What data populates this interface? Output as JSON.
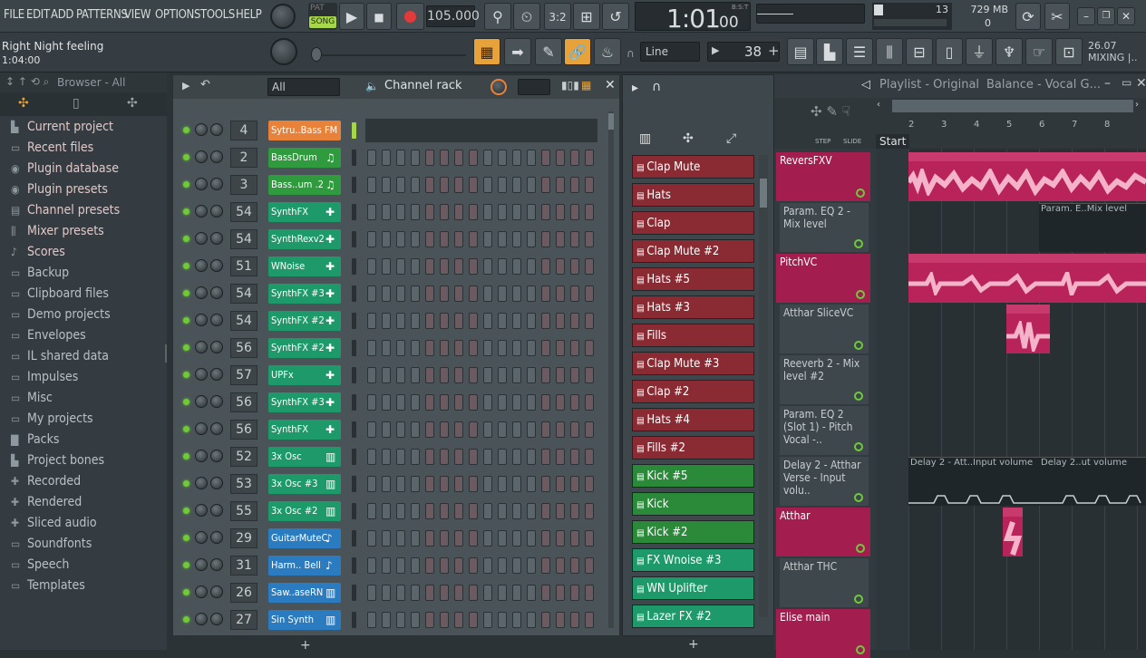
{
  "menu": [
    "FILE",
    "EDIT",
    "ADD",
    "PATTERNS",
    "VIEW",
    "OPTIONS",
    "TOOLS",
    "HELP"
  ],
  "transport": {
    "pat_label": "PAT",
    "song_label": "SONG",
    "tempo": "105.000",
    "time": "1:01",
    "time_sub": "00",
    "bst": "B:S:T"
  },
  "meters": {
    "cpu": "13",
    "mem": "729 MB",
    "poly": "0"
  },
  "hint": {
    "title": "Right Night feeling",
    "time": "1:04:00"
  },
  "toolbar2": {
    "snap": "Line",
    "step_value": "38",
    "news_date": "26.07",
    "news_text": "MIXING |.."
  },
  "browser": {
    "title": "Browser - All",
    "items": [
      {
        "label": "Current project",
        "icon": "project-icon"
      },
      {
        "label": "Recent files",
        "icon": "folder-recent-icon"
      },
      {
        "label": "Plugin database",
        "icon": "plugin-icon"
      },
      {
        "label": "Plugin presets",
        "icon": "plugin-icon"
      },
      {
        "label": "Channel presets",
        "icon": "channel-icon"
      },
      {
        "label": "Mixer presets",
        "icon": "mixer-icon"
      },
      {
        "label": "Scores",
        "icon": "note-icon"
      },
      {
        "label": "Backup",
        "icon": "folder-backup-icon"
      },
      {
        "label": "Clipboard files",
        "icon": "folder-icon"
      },
      {
        "label": "Demo projects",
        "icon": "folder-icon"
      },
      {
        "label": "Envelopes",
        "icon": "folder-icon"
      },
      {
        "label": "IL shared data",
        "icon": "folder-icon"
      },
      {
        "label": "Impulses",
        "icon": "folder-icon"
      },
      {
        "label": "Misc",
        "icon": "folder-icon"
      },
      {
        "label": "My projects",
        "icon": "folder-icon"
      },
      {
        "label": "Packs",
        "icon": "packs-icon"
      },
      {
        "label": "Project bones",
        "icon": "bones-icon"
      },
      {
        "label": "Recorded",
        "icon": "recorded-icon"
      },
      {
        "label": "Rendered",
        "icon": "rendered-icon"
      },
      {
        "label": "Sliced audio",
        "icon": "sliced-icon"
      },
      {
        "label": "Soundfonts",
        "icon": "folder-icon"
      },
      {
        "label": "Speech",
        "icon": "folder-icon"
      },
      {
        "label": "Templates",
        "icon": "folder-icon"
      }
    ]
  },
  "rack": {
    "filter": "All",
    "title": "Channel rack",
    "channels": [
      {
        "num": "4",
        "name": "Sytru..Bass FM",
        "color": "#e8823a",
        "icon": ""
      },
      {
        "num": "2",
        "name": "BassDrum",
        "color": "#2f9a3e",
        "icon": "♫"
      },
      {
        "num": "3",
        "name": "Bass..um .2",
        "color": "#2f9a3e",
        "icon": "♫"
      },
      {
        "num": "54",
        "name": "SynthFX",
        "color": "#1e9a6a",
        "icon": "✚"
      },
      {
        "num": "54",
        "name": "SynthRexv2",
        "color": "#1e9a6a",
        "icon": "✚"
      },
      {
        "num": "51",
        "name": "WNoise",
        "color": "#1e9a6a",
        "icon": "✚"
      },
      {
        "num": "54",
        "name": "SynthFX #3",
        "color": "#1e9a6a",
        "icon": "✚"
      },
      {
        "num": "54",
        "name": "SynthFX #2",
        "color": "#1e9a6a",
        "icon": "✚"
      },
      {
        "num": "56",
        "name": "SynthFX #2",
        "color": "#1e9a6a",
        "icon": "✚"
      },
      {
        "num": "57",
        "name": "UPFx",
        "color": "#1e9a6a",
        "icon": "✚"
      },
      {
        "num": "56",
        "name": "SynthFX #3",
        "color": "#1e9a6a",
        "icon": "✚"
      },
      {
        "num": "56",
        "name": "SynthFX",
        "color": "#1e9a6a",
        "icon": "✚"
      },
      {
        "num": "52",
        "name": "3x Osc",
        "color": "#1e9a6a",
        "icon": "▥"
      },
      {
        "num": "53",
        "name": "3x Osc #3",
        "color": "#1e9a6a",
        "icon": "▥"
      },
      {
        "num": "55",
        "name": "3x Osc #2",
        "color": "#1e9a6a",
        "icon": "▥"
      },
      {
        "num": "29",
        "name": "GuitarMuteC",
        "color": "#2a7bbf",
        "icon": "♪"
      },
      {
        "num": "31",
        "name": "Harm..  Bell",
        "color": "#2a7bbf",
        "icon": "♪"
      },
      {
        "num": "26",
        "name": "Saw..aseRN",
        "color": "#2a7bbf",
        "icon": "▥"
      },
      {
        "num": "27",
        "name": "Sin Synth",
        "color": "#2a7bbf",
        "icon": "▥"
      }
    ]
  },
  "patterns": [
    {
      "name": "Clap Mute",
      "color": "#8a2b33"
    },
    {
      "name": "Hats",
      "color": "#8a2b33"
    },
    {
      "name": "Clap",
      "color": "#8a2b33"
    },
    {
      "name": "Clap Mute #2",
      "color": "#8a2b33"
    },
    {
      "name": "Hats #5",
      "color": "#8a2b33"
    },
    {
      "name": "Hats #3",
      "color": "#8a2b33"
    },
    {
      "name": "Fills",
      "color": "#8a2b33"
    },
    {
      "name": "Clap Mute #3",
      "color": "#8a2b33"
    },
    {
      "name": "Clap #2",
      "color": "#8a2b33"
    },
    {
      "name": "Hats #4",
      "color": "#8a2b33"
    },
    {
      "name": "Fills #2",
      "color": "#8a2b33"
    },
    {
      "name": "Kick #5",
      "color": "#2a8a3a"
    },
    {
      "name": "Kick",
      "color": "#2a8a3a"
    },
    {
      "name": "Kick #2",
      "color": "#2a8a3a"
    },
    {
      "name": "FX Wnoise #3",
      "color": "#1e9a6a"
    },
    {
      "name": "WN Uplifter",
      "color": "#1e9a6a"
    },
    {
      "name": "Lazer FX #2",
      "color": "#1e9a6a"
    }
  ],
  "playlist": {
    "title": "Playlist - Original",
    "subtitle": "Balance - Vocal G...",
    "step_label": "STEP",
    "slide_label": "SLIDE",
    "start_marker": "Start",
    "bars": [
      "2",
      "3",
      "4",
      "5",
      "6",
      "7",
      "8"
    ],
    "tracks": [
      {
        "name": "ReversFXV",
        "kind": "main"
      },
      {
        "name": "Param. EQ 2 - Mix level",
        "kind": "auto"
      },
      {
        "name": "PitchVC",
        "kind": "main"
      },
      {
        "name": "Atthar SliceVC",
        "kind": "auto"
      },
      {
        "name": "Reeverb 2 - Mix level #2",
        "kind": "auto"
      },
      {
        "name": "Param. EQ 2 (Slot 1) - Pitch Vocal -..",
        "kind": "auto"
      },
      {
        "name": "Delay 2 - Atthar Verse - Input volu..",
        "kind": "auto"
      },
      {
        "name": "Atthar",
        "kind": "main"
      },
      {
        "name": "Atthar THC",
        "kind": "auto"
      },
      {
        "name": "Elise main",
        "kind": "main"
      }
    ],
    "clips": {
      "c1": "ReversFXV",
      "c2": "Param. E..Mix level",
      "c3": "PitchVC",
      "c4": "SliceVC",
      "c5": "Delay 2 - Att..Input volume",
      "c6": "Delay 2..ut volume"
    }
  }
}
